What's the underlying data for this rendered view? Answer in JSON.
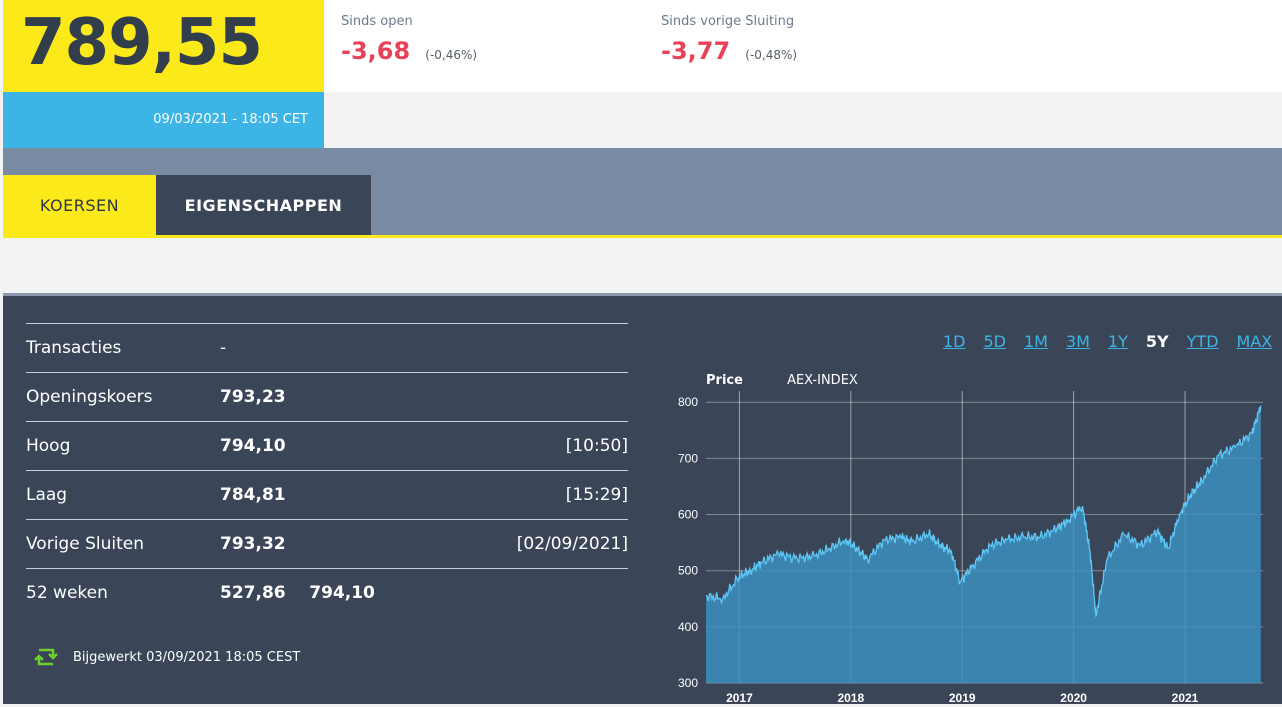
{
  "quote": {
    "price": "789,55",
    "timestamp": "09/03/2021 - 18:05  CET",
    "since_open_label": "Sinds open",
    "since_open_value": "-3,68",
    "since_open_pct": "(-0,46%)",
    "since_close_label": "Sinds vorige Sluiting",
    "since_close_value": "-3,77",
    "since_close_pct": "(-0,48%)"
  },
  "tabs": {
    "koersen": "KOERSEN",
    "eigenschappen": "EIGENSCHAPPEN"
  },
  "stats": [
    {
      "label": "Transacties",
      "value": "-",
      "extra": ""
    },
    {
      "label": "Openingskoers",
      "value": "793,23",
      "extra": ""
    },
    {
      "label": "Hoog",
      "value": "794,10",
      "extra": "[10:50]"
    },
    {
      "label": "Laag",
      "value": "784,81",
      "extra": "[15:29]"
    },
    {
      "label": "Vorige Sluiten",
      "value": "793,32",
      "extra": "[02/09/2021]"
    },
    {
      "label": "52 weken",
      "value": "527,86    794,10",
      "extra": ""
    }
  ],
  "updated": "Bijgewerkt 03/09/2021 18:05 CEST",
  "periods": [
    "1D",
    "5D",
    "1M",
    "3M",
    "1Y",
    "5Y",
    "YTD",
    "MAX"
  ],
  "active_period": "5Y",
  "colors": {
    "accent_yellow": "#fce91a",
    "accent_blue": "#3db4e6",
    "negative": "#e8425a",
    "panel": "#3a4658"
  },
  "chart_data": {
    "type": "area",
    "title": "",
    "legend": {
      "price_label": "Price",
      "series_name": "AEX-INDEX"
    },
    "xlabel": "",
    "ylabel": "",
    "ylim": [
      300,
      820
    ],
    "xlim": [
      2016.7,
      2021.7
    ],
    "y_ticks": [
      300,
      400,
      500,
      600,
      700,
      800
    ],
    "x_ticks": [
      2017,
      2018,
      2019,
      2020,
      2021
    ],
    "grid": true,
    "series": [
      {
        "name": "AEX-INDEX",
        "x": [
          2016.7,
          2016.85,
          2017.0,
          2017.1,
          2017.2,
          2017.35,
          2017.5,
          2017.65,
          2017.8,
          2017.95,
          2018.05,
          2018.15,
          2018.3,
          2018.45,
          2018.55,
          2018.7,
          2018.8,
          2018.9,
          2018.98,
          2019.1,
          2019.25,
          2019.4,
          2019.55,
          2019.7,
          2019.85,
          2019.95,
          2020.08,
          2020.15,
          2020.2,
          2020.3,
          2020.45,
          2020.6,
          2020.75,
          2020.85,
          2020.95,
          2021.05,
          2021.15,
          2021.3,
          2021.45,
          2021.6,
          2021.68
        ],
        "values": [
          455,
          450,
          490,
          500,
          515,
          530,
          522,
          525,
          538,
          555,
          540,
          520,
          555,
          560,
          552,
          565,
          545,
          535,
          480,
          510,
          545,
          555,
          560,
          560,
          575,
          590,
          615,
          530,
          420,
          520,
          565,
          545,
          570,
          540,
          600,
          635,
          660,
          705,
          720,
          745,
          794
        ]
      }
    ]
  }
}
